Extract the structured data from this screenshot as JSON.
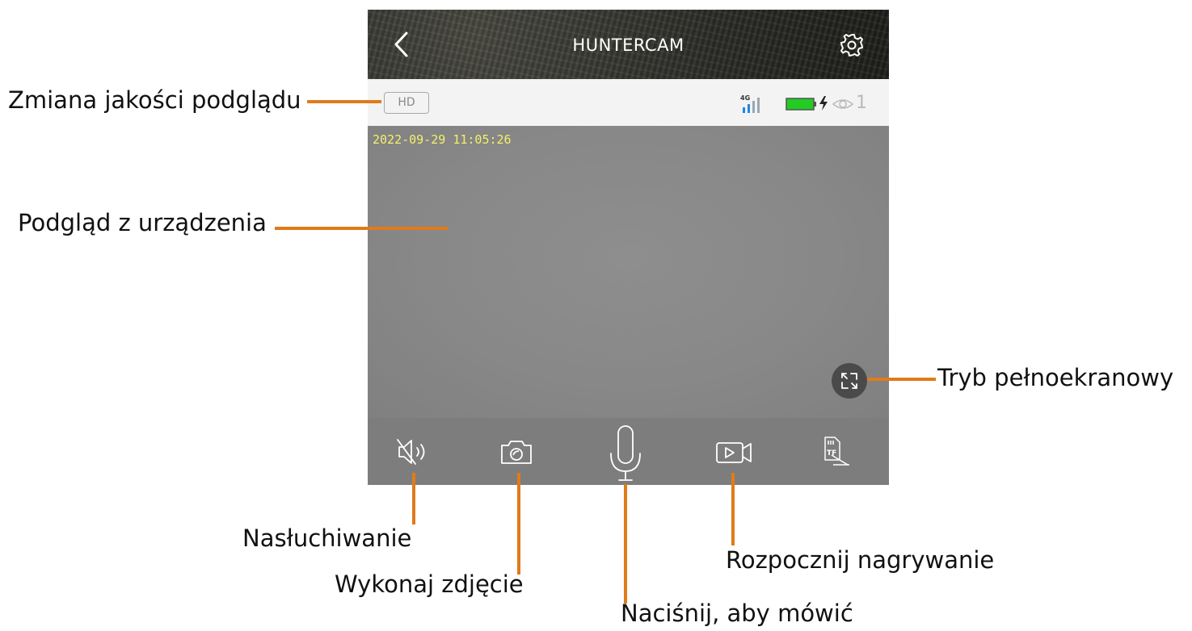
{
  "app": {
    "title": "HUNTERCAM",
    "quality_button": "HD",
    "network": "4G",
    "viewer_count": "1",
    "timestamp": "2022-09-29 11:05:26",
    "colors": {
      "accent": "#e07b1a",
      "battery": "#22cc22",
      "signal": "#1e88e5",
      "timestamp": "#f4f06a",
      "toolbar": "#7d7d7d"
    },
    "icons": [
      "back-icon",
      "gear-icon",
      "signal-icon",
      "battery-icon",
      "bolt-icon",
      "eye-icon",
      "fullscreen-icon",
      "speaker-muted-icon",
      "camera-icon",
      "microphone-icon",
      "video-record-icon",
      "sd-card-icon"
    ]
  },
  "annotations": {
    "quality": "Zmiana jakości podglądu",
    "preview": "Podgląd z urządzenia",
    "fullscreen": "Tryb pełnoekranowy",
    "listen": "Nasłuchiwanie",
    "snapshot": "Wykonaj zdjęcie",
    "talk": "Naciśnij, aby mówić",
    "record": "Rozpocznij nagrywanie"
  }
}
